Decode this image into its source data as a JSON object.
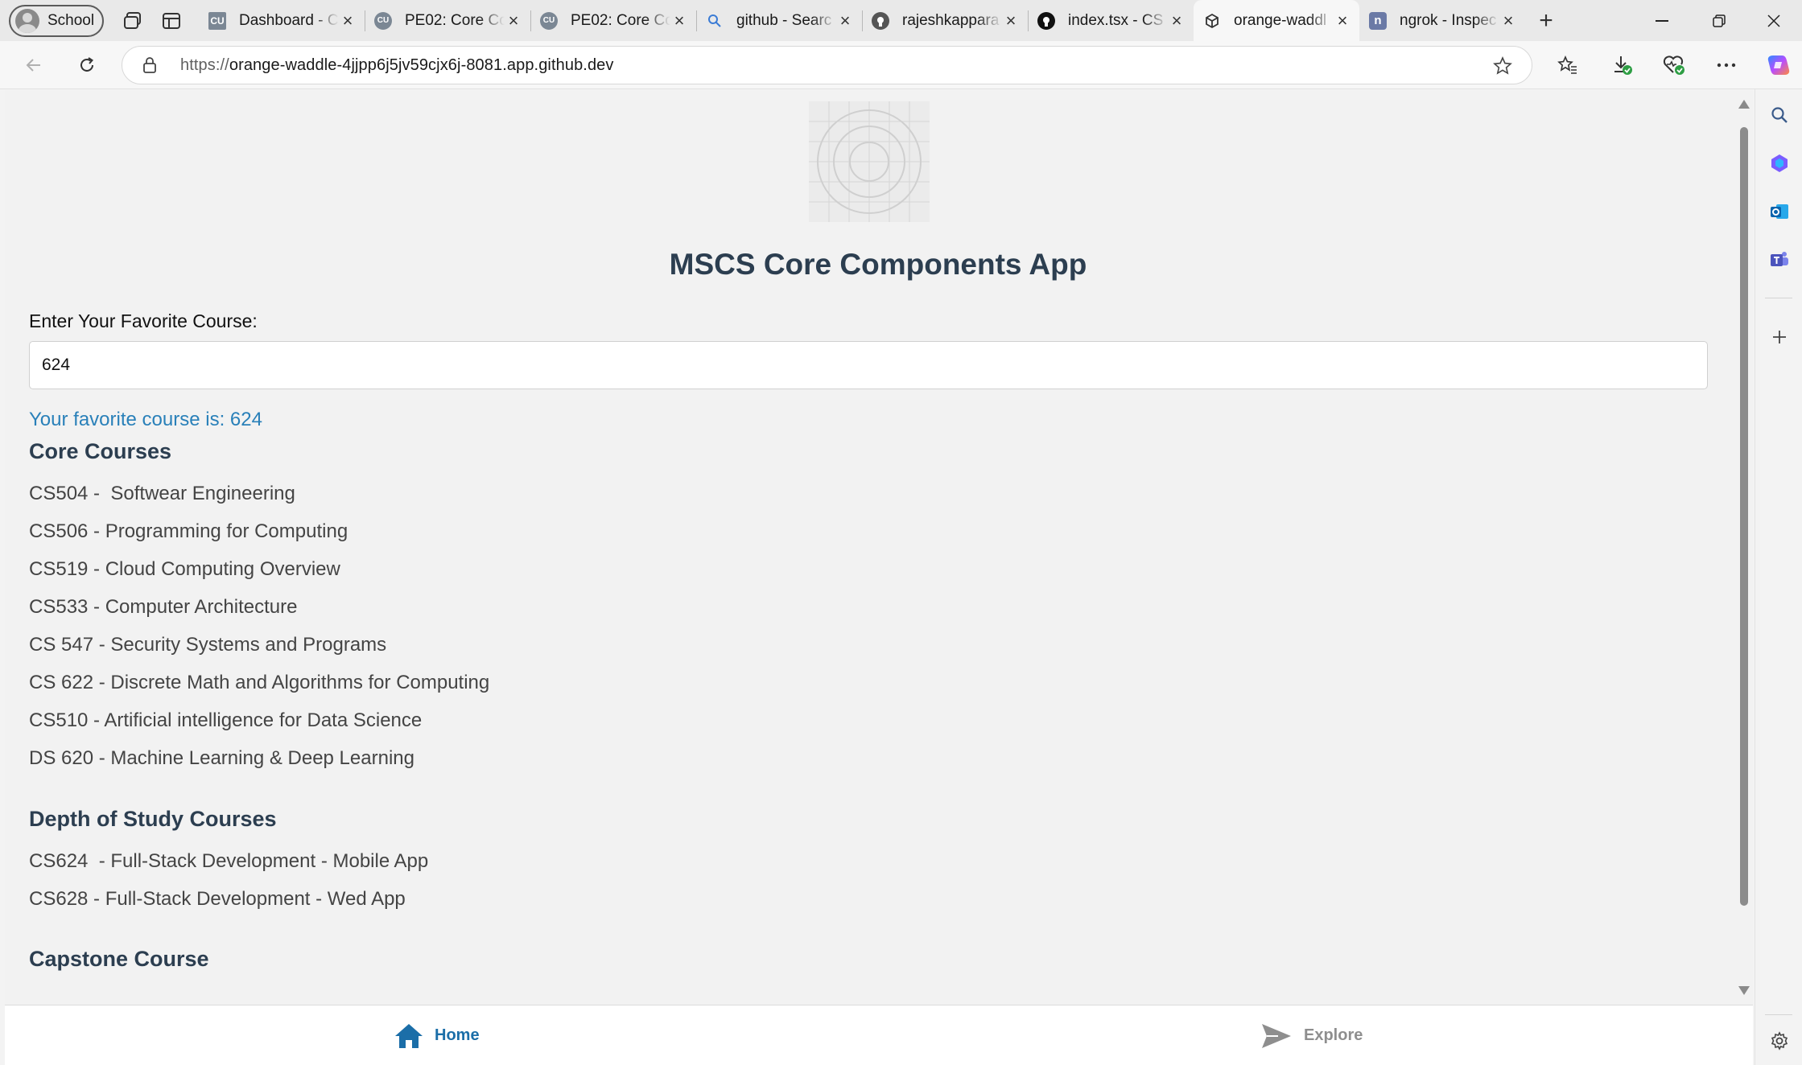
{
  "browser": {
    "profile_label": "School",
    "tabs": [
      {
        "title": "Dashboard - C",
        "favicon": "cu-icon",
        "active": false
      },
      {
        "title": "PE02: Core Co",
        "favicon": "cu-round-icon",
        "active": false
      },
      {
        "title": "PE02: Core Co",
        "favicon": "cu-round-icon",
        "active": false
      },
      {
        "title": "github - Searc",
        "favicon": "search-icon",
        "active": false
      },
      {
        "title": "rajeshkappara",
        "favicon": "github-icon",
        "active": false
      },
      {
        "title": "index.tsx - CS",
        "favicon": "github-icon",
        "active": false
      },
      {
        "title": "orange-waddl",
        "favicon": "codespace-icon",
        "active": true
      },
      {
        "title": "ngrok - Inspec",
        "favicon": "ngrok-icon",
        "active": false
      }
    ],
    "url_protocol": "https://",
    "url_host": "orange-waddle-4jjpp6j5jv59cjx6j-8081.app.github.dev"
  },
  "app": {
    "title": "MSCS Core Components App",
    "input_label": "Enter Your Favorite Course:",
    "input_value": "624",
    "favorite_text": "Your favorite course is: 624",
    "sections": {
      "core": {
        "heading": "Core Courses",
        "items": [
          "CS504 -  Softwear Engineering",
          "CS506 - Programming for Computing",
          "CS519 - Cloud Computing Overview",
          "CS533 - Computer Architecture",
          "CS 547 - Security Systems and Programs",
          "CS 622 - Discrete Math and Algorithms for Computing",
          "CS510 - Artificial intelligence for Data Science",
          "DS 620 - Machine Learning & Deep Learning"
        ]
      },
      "depth": {
        "heading": "Depth of Study Courses",
        "items": [
          "CS624  - Full-Stack Development - Mobile App",
          "CS628 - Full-Stack Development - Wed App"
        ]
      },
      "capstone": {
        "heading": "Capstone Course"
      }
    },
    "bottom_tabs": {
      "home": "Home",
      "explore": "Explore"
    }
  },
  "colors": {
    "heading": "#2c3e50",
    "favorite_text": "#2980b9",
    "active_tab": "#1b6ea8",
    "inactive_tab": "#8e8e8e"
  }
}
